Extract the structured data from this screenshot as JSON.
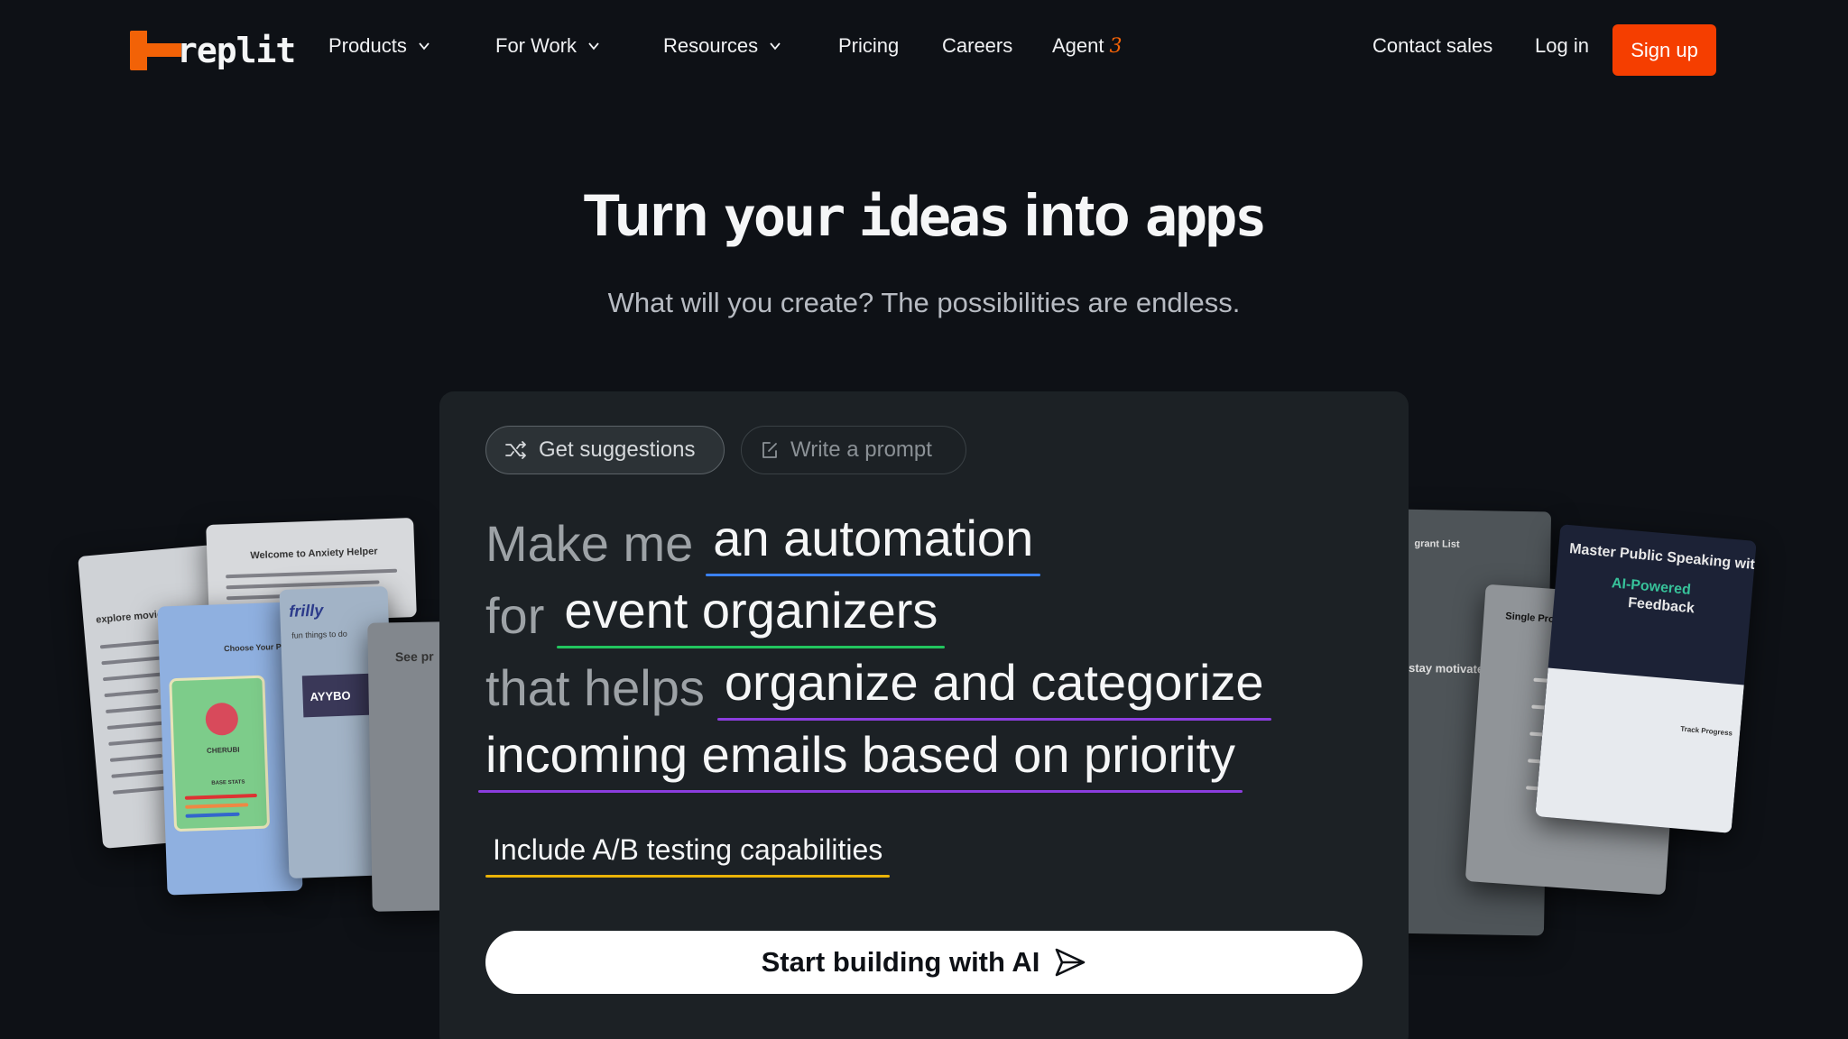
{
  "nav": {
    "brand": "replit",
    "items": [
      {
        "label": "Products",
        "has_dropdown": true
      },
      {
        "label": "For Work",
        "has_dropdown": true
      },
      {
        "label": "Resources",
        "has_dropdown": true
      },
      {
        "label": "Pricing",
        "has_dropdown": false
      },
      {
        "label": "Careers",
        "has_dropdown": false
      }
    ],
    "agent_label": "Agent",
    "agent_version": "3",
    "contact_sales": "Contact sales",
    "login": "Log in",
    "signup": "Sign up"
  },
  "hero": {
    "title_part1": "Turn ",
    "title_pix1": "your",
    "title_part2": " ",
    "title_pix2": "ideas",
    "title_part3": " into ",
    "title_pix3": "apps",
    "subtitle": "What will you create? The possibilities are endless."
  },
  "prompt_panel": {
    "tabs": {
      "suggestions": "Get suggestions",
      "write": "Write a prompt"
    },
    "lines": [
      {
        "lead": "Make me",
        "value": "an automation",
        "color": "#3b82f6"
      },
      {
        "lead": "for",
        "value": "event organizers",
        "color": "#22c55e"
      },
      {
        "lead": "that helps",
        "value": "organize and categorize",
        "color": "#8b3dde"
      },
      {
        "lead": "",
        "value": "incoming emails based on priority",
        "color": "#8b3dde"
      }
    ],
    "extra": "Include A/B testing capabilities",
    "cta": "Start building with AI"
  },
  "collage": {
    "left": {
      "card1_title": "explore movies",
      "card2_title": "Welcome to Anxiety Helper",
      "card3_title": "Choose Your P",
      "card3_name": "CHERUBI",
      "card3_stats": "BASE STATS",
      "card4_brand": "frilly",
      "card4_text": "fun things to do",
      "card4_event": "AYYBO",
      "card5_text": "See pr"
    },
    "right": {
      "card1_title": "grant List",
      "card2_text": "stay motivated",
      "card3_title": "Single Property Loan Calculator",
      "card4_title": "Master Public Speaking with",
      "card4_accent": "AI-Powered",
      "card4_tail": "Feedback",
      "card4_sub": "Track Progress"
    }
  },
  "colors": {
    "background": "#0e1116",
    "panel": "#1c2125",
    "brand_orange": "#f26207",
    "signup": "#f53e00"
  }
}
